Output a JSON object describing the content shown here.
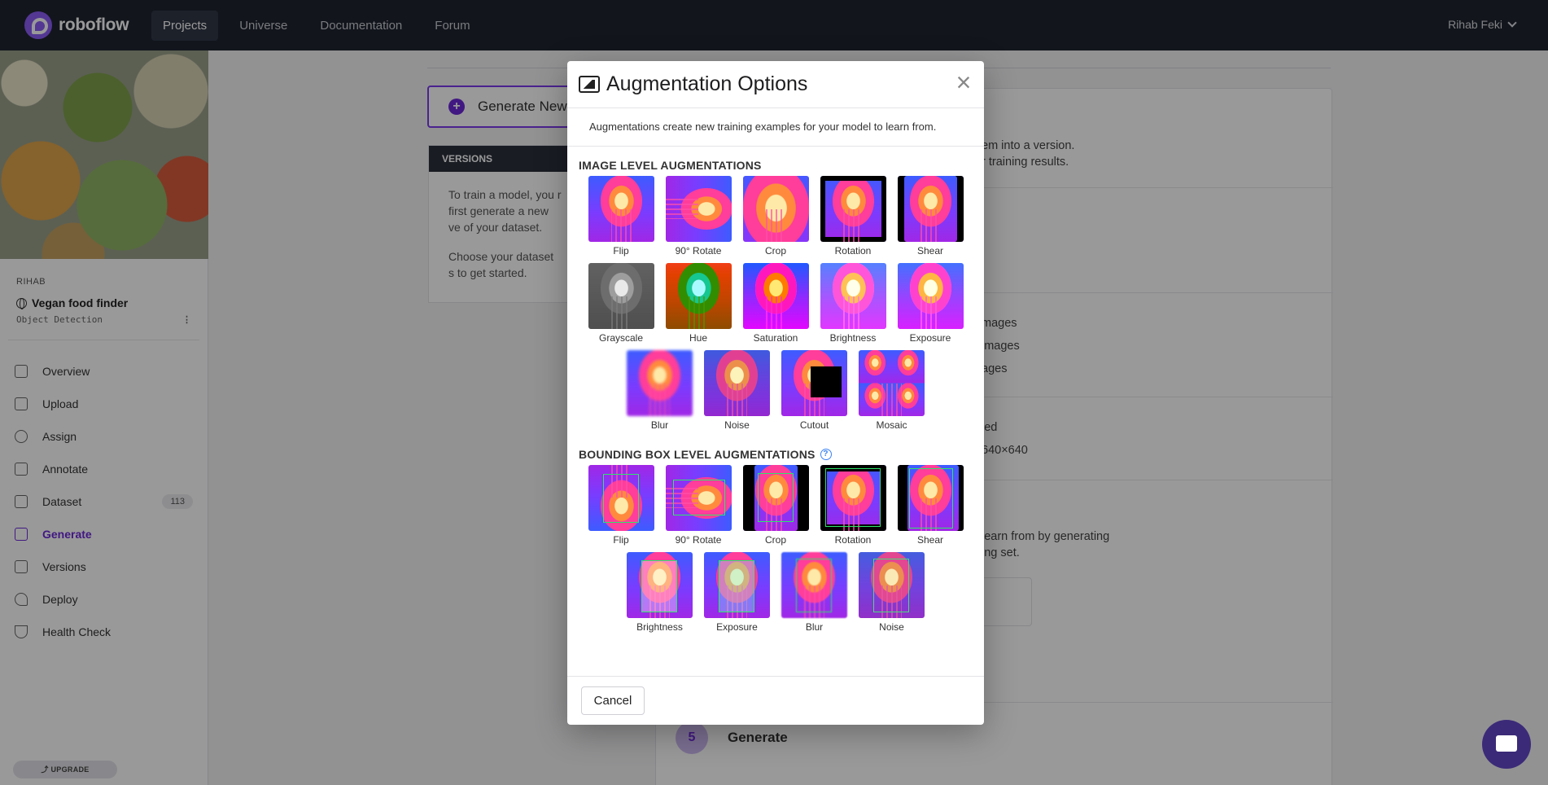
{
  "brand": {
    "name": "roboflow"
  },
  "nav": {
    "items": [
      "Projects",
      "Universe",
      "Documentation",
      "Forum"
    ],
    "user": "Rihab Feki"
  },
  "project": {
    "owner": "RIHAB",
    "name": "Vegan food finder",
    "type": "Object Detection"
  },
  "sidebar": {
    "items": [
      {
        "label": "Overview",
        "icon": "overview-icon"
      },
      {
        "label": "Upload",
        "icon": "upload-icon"
      },
      {
        "label": "Assign",
        "icon": "search-icon"
      },
      {
        "label": "Annotate",
        "icon": "annotate-icon"
      },
      {
        "label": "Dataset",
        "icon": "dataset-icon",
        "badge": "113"
      },
      {
        "label": "Generate",
        "icon": "generate-icon",
        "active": true
      },
      {
        "label": "Versions",
        "icon": "versions-icon"
      },
      {
        "label": "Deploy",
        "icon": "rocket-icon"
      },
      {
        "label": "Health Check",
        "icon": "stethoscope-icon"
      }
    ],
    "upgrade": "⤴ UPGRADE"
  },
  "main": {
    "generate_btn": "Generate New",
    "versions_header": "VERSIONS",
    "versions_p1": "To train a model, you r first generate a new ve of your dataset.",
    "versions_p2": "Choose your dataset s to get started.",
    "step_texts": [
      "em into a version.",
      "r training results.",
      "mages",
      "images",
      "ages",
      "ied",
      "640×640",
      "learn from by generating",
      "ing set."
    ],
    "step5_num": "5",
    "step5_title": "Generate"
  },
  "modal": {
    "title": "Augmentation Options",
    "close": "×",
    "description": "Augmentations create new training examples for your model to learn from.",
    "image_section_title": "IMAGE LEVEL AUGMENTATIONS",
    "image_level": [
      "Flip",
      "90° Rotate",
      "Crop",
      "Rotation",
      "Shear",
      "Grayscale",
      "Hue",
      "Saturation",
      "Brightness",
      "Exposure",
      "Blur",
      "Noise",
      "Cutout",
      "Mosaic"
    ],
    "bbox_section_title": "BOUNDING BOX LEVEL AUGMENTATIONS",
    "bbox_level": [
      "Flip",
      "90° Rotate",
      "Crop",
      "Rotation",
      "Shear",
      "Brightness",
      "Exposure",
      "Blur",
      "Noise"
    ],
    "cancel": "Cancel"
  },
  "colors": {
    "accent": "#6d28d9",
    "topbar": "#1f2430",
    "bbox": "#2ee66a"
  }
}
